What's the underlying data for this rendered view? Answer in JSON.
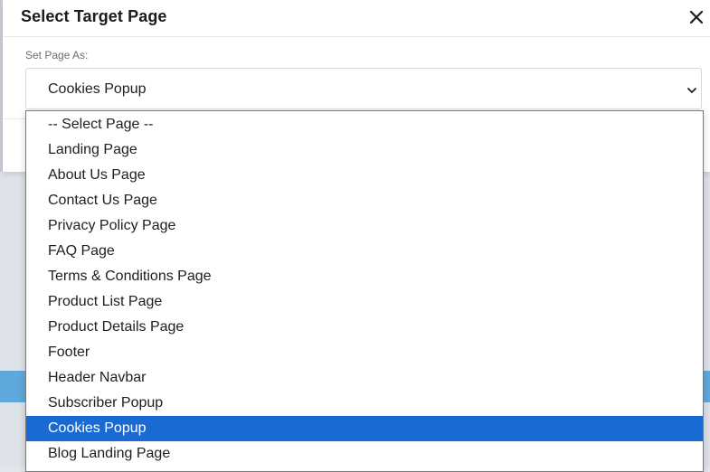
{
  "modal": {
    "title": "Select Target Page",
    "close_icon": "close-icon"
  },
  "field": {
    "label": "Set Page As:",
    "selected_value": "Cookies Popup",
    "chevron_icon": "chevron-down-icon"
  },
  "dropdown": {
    "selected_index": 12,
    "options": [
      {
        "label": "-- Select Page --"
      },
      {
        "label": "Landing Page"
      },
      {
        "label": "About Us Page"
      },
      {
        "label": "Contact Us Page"
      },
      {
        "label": "Privacy Policy Page"
      },
      {
        "label": "FAQ Page"
      },
      {
        "label": "Terms & Conditions Page"
      },
      {
        "label": "Product List Page"
      },
      {
        "label": "Product Details Page"
      },
      {
        "label": "Footer"
      },
      {
        "label": "Header Navbar"
      },
      {
        "label": "Subscriber Popup"
      },
      {
        "label": "Cookies Popup"
      },
      {
        "label": "Blog Landing Page"
      }
    ]
  },
  "colors": {
    "selected_option_bg": "#1a6ad4",
    "backdrop_band": "#5ea9dc"
  }
}
